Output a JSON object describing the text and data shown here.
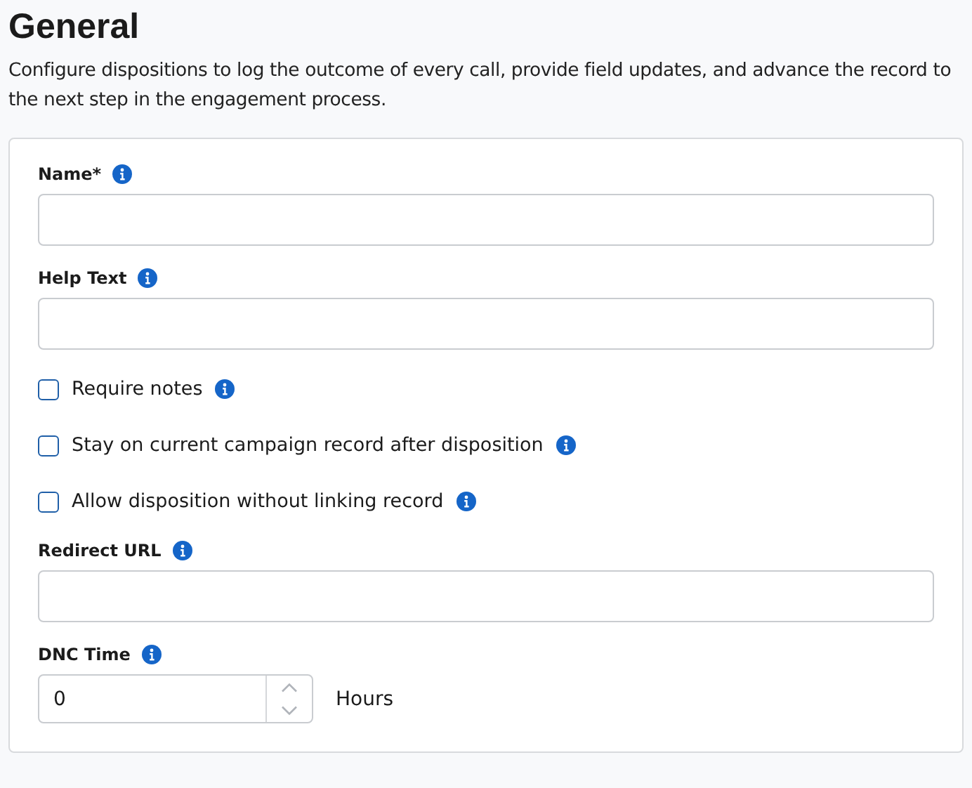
{
  "heading": "General",
  "description": "Configure dispositions to log the outcome of every call, provide field updates, and advance the record to the next step in the engagement process.",
  "fields": [
    {
      "kind": "text",
      "label": "Name*"
    },
    {
      "kind": "text",
      "label": "Help Text"
    },
    {
      "kind": "checkbox",
      "label": "Require notes",
      "checked": false
    },
    {
      "kind": "checkbox",
      "label": "Stay on current campaign record after disposition",
      "checked": false
    },
    {
      "kind": "checkbox",
      "label": "Allow disposition without linking record",
      "checked": false
    },
    {
      "kind": "text",
      "label": "Redirect URL"
    },
    {
      "kind": "number",
      "label": "DNC Time",
      "value": "0",
      "unit": "Hours"
    }
  ]
}
